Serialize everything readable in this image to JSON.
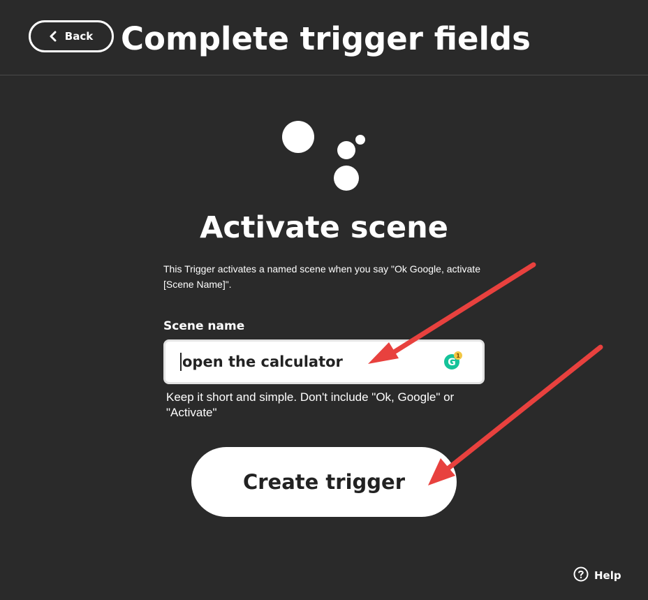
{
  "header": {
    "back_label": "Back",
    "title": "Complete trigger fields"
  },
  "service": {
    "icon": "google-assistant-dots-icon"
  },
  "trigger": {
    "title": "Activate scene",
    "description": "This Trigger activates a named scene when you say \"Ok Google, activate [Scene Name]\"."
  },
  "form": {
    "field_label": "Scene name",
    "field_value": "open the calculator",
    "grammarly_badge_count": "1",
    "helper_text": "Keep it short and simple. Don't include \"Ok, Google\" or \"Activate\"",
    "submit_label": "Create trigger"
  },
  "footer": {
    "help_label": "Help"
  },
  "colors": {
    "background": "#2a2a2a",
    "text": "#ffffff",
    "button_background": "#ffffff",
    "button_text": "#222222",
    "annotation_arrow": "#e8413e",
    "grammarly_green": "#15c39a"
  }
}
